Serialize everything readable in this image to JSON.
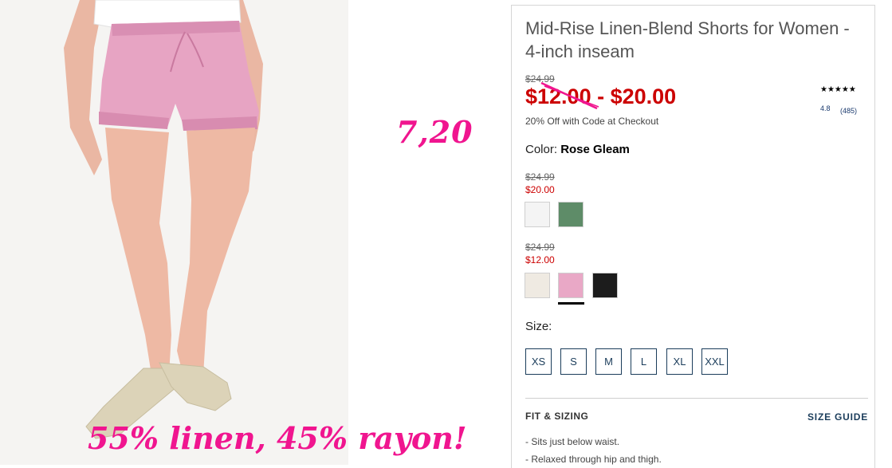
{
  "annotations": {
    "price_note": "7,20",
    "fabric_note": "55% linen, 45% rayon!"
  },
  "product": {
    "title_line1": "Mid-Rise Linen-Blend Shorts for Women -",
    "title_line2": "4-inch inseam",
    "regular_price": "$24.99",
    "sale_price": "$12.00 - $20.00",
    "promo": "20% Off with Code at Checkout",
    "rating_value": "4.8",
    "rating_count": "(485)",
    "stars": "★★★★★",
    "color_label": "Color:",
    "color_value": "Rose Gleam"
  },
  "price_groups": [
    {
      "regular": "$24.99",
      "sale": "$20.00",
      "swatches": [
        {
          "name": "white",
          "color": "#f4f4f4"
        },
        {
          "name": "green",
          "color": "#5e8c68"
        }
      ]
    },
    {
      "regular": "$24.99",
      "sale": "$12.00",
      "swatches": [
        {
          "name": "cream",
          "color": "#efeae2"
        },
        {
          "name": "rose-gleam",
          "color": "#e9a8c6",
          "selected": true
        },
        {
          "name": "black",
          "color": "#1c1c1c"
        }
      ]
    }
  ],
  "sizes": {
    "label": "Size:",
    "options": [
      "XS",
      "S",
      "M",
      "L",
      "XL",
      "XXL"
    ]
  },
  "fit": {
    "title": "FIT & SIZING",
    "size_guide": "SIZE GUIDE",
    "bullets": [
      "-  Sits just below waist.",
      "-  Relaxed through hip and thigh."
    ]
  },
  "colors": {
    "sale_red": "#cc0000",
    "annotation_pink": "#f0158f",
    "navy": "#1b3d5b"
  }
}
